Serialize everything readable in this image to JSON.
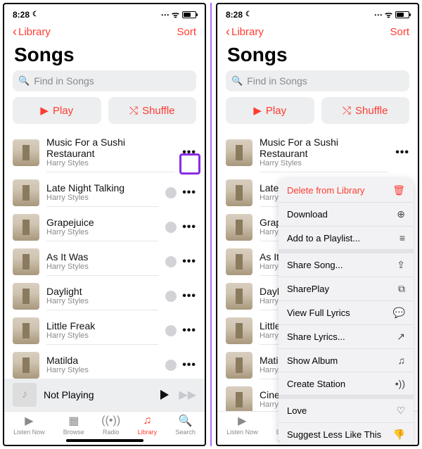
{
  "statusbar": {
    "time": "8:28"
  },
  "nav": {
    "back": "Library",
    "sort": "Sort"
  },
  "title": "Songs",
  "search": {
    "placeholder": "Find in Songs"
  },
  "buttons": {
    "play": "Play",
    "shuffle": "Shuffle"
  },
  "songs": [
    {
      "title": "Music For a Sushi Restaurant",
      "artist": "Harry Styles"
    },
    {
      "title": "Late Night Talking",
      "artist": "Harry Styles"
    },
    {
      "title": "Grapejuice",
      "artist": "Harry Styles"
    },
    {
      "title": "As It Was",
      "artist": "Harry Styles"
    },
    {
      "title": "Daylight",
      "artist": "Harry Styles"
    },
    {
      "title": "Little Freak",
      "artist": "Harry Styles"
    },
    {
      "title": "Matilda",
      "artist": "Harry Styles"
    },
    {
      "title": "Cinema",
      "artist": "Harry Styles"
    }
  ],
  "songs_right_truncated": [
    {
      "title": "Music For a Sushi Restaurant",
      "artist": "Harry Styles"
    },
    {
      "title": "Late N",
      "artist": "Harry S"
    },
    {
      "title": "Grape",
      "artist": "Harry S"
    },
    {
      "title": "As It V",
      "artist": "Harry S"
    },
    {
      "title": "Daylig",
      "artist": "Harry S"
    },
    {
      "title": "Little",
      "artist": "Harry S"
    },
    {
      "title": "Matild",
      "artist": "Harry S"
    },
    {
      "title": "Cinem",
      "artist": "Harry S"
    }
  ],
  "nowplaying": {
    "label": "Not Playing"
  },
  "tabs": [
    {
      "label": "Listen Now",
      "glyph": "▶"
    },
    {
      "label": "Browse",
      "glyph": "▦"
    },
    {
      "label": "Radio",
      "glyph": "((•))"
    },
    {
      "label": "Library",
      "glyph": "♫"
    },
    {
      "label": "Search",
      "glyph": "🔍"
    }
  ],
  "activeTab": 3,
  "context_menu": [
    {
      "label": "Delete from Library",
      "icon": "🗑",
      "red": true
    },
    {
      "label": "Download",
      "icon": "⊕",
      "highlighted": true
    },
    {
      "label": "Add to a Playlist...",
      "icon": "≡"
    },
    {
      "label": "Share Song...",
      "icon": "⇪",
      "groupStart": true
    },
    {
      "label": "SharePlay",
      "icon": "⧉"
    },
    {
      "label": "View Full Lyrics",
      "icon": "💬"
    },
    {
      "label": "Share Lyrics...",
      "icon": "↗"
    },
    {
      "label": "Show Album",
      "icon": "♫"
    },
    {
      "label": "Create Station",
      "icon": "•))"
    },
    {
      "label": "Love",
      "icon": "♡",
      "groupStart": true
    },
    {
      "label": "Suggest Less Like This",
      "icon": "👎"
    }
  ]
}
